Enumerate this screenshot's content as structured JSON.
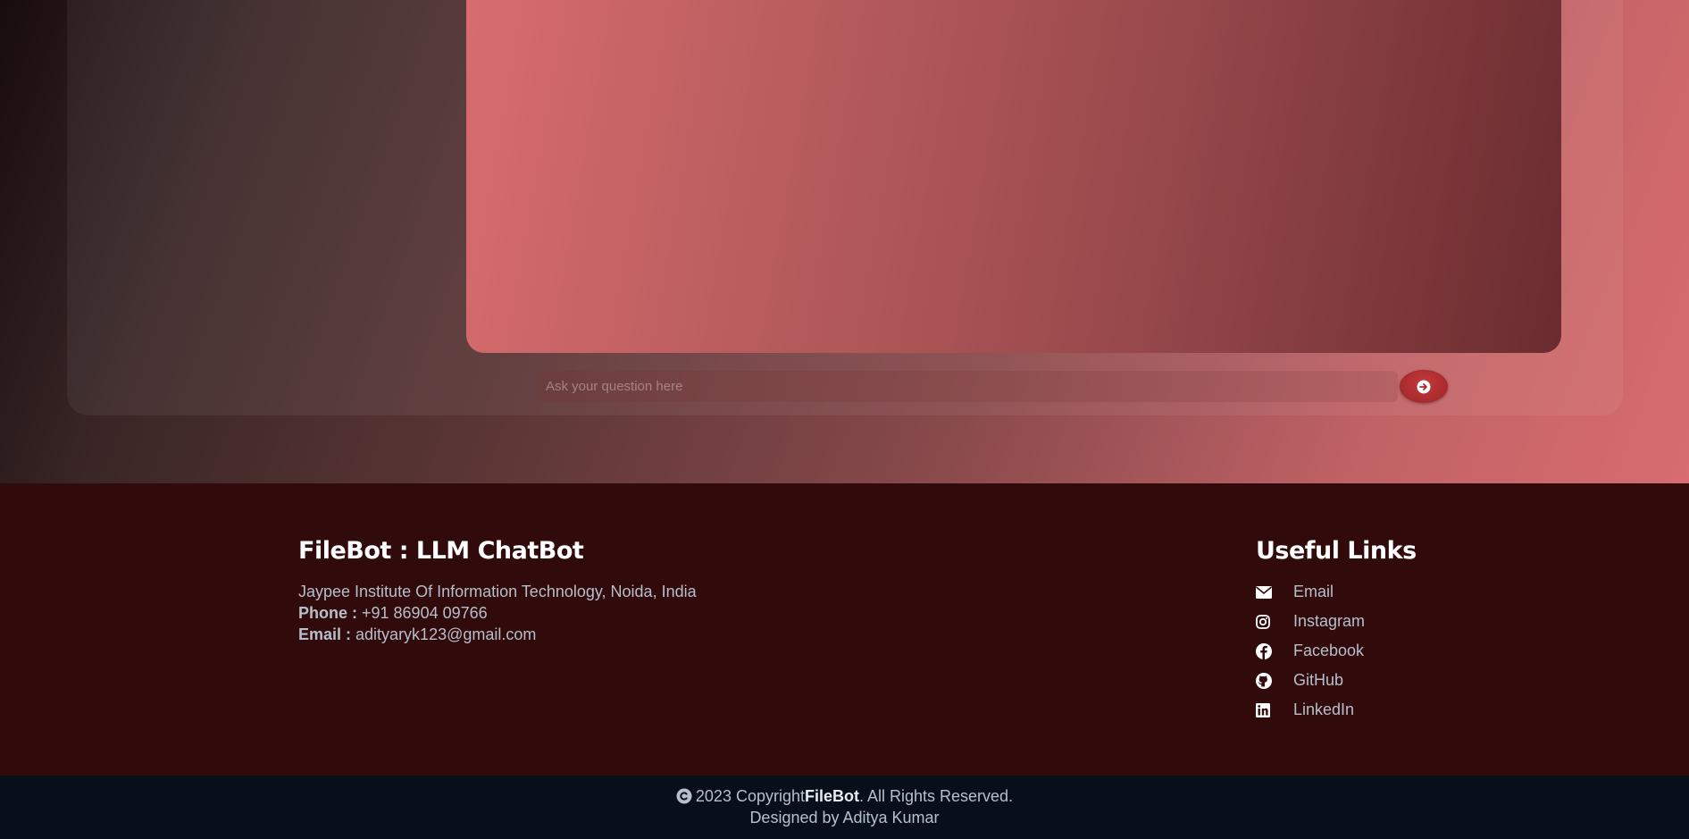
{
  "chat": {
    "input_placeholder": "Ask your question here",
    "send_icon": "arrow-right-circle-icon"
  },
  "footer": {
    "brand": {
      "title": "FileBot : LLM ChatBot",
      "address": "Jaypee Institute Of Information Technology, Noida, India",
      "phone_label": "Phone :",
      "phone_value": " +91 86904 09766",
      "email_label": "Email :",
      "email_value": " adityaryk123@gmail.com"
    },
    "useful_links": {
      "title": "Useful Links",
      "items": [
        {
          "label": "Email",
          "icon": "envelope-icon"
        },
        {
          "label": "Instagram",
          "icon": "instagram-icon"
        },
        {
          "label": "Facebook",
          "icon": "facebook-icon"
        },
        {
          "label": "GitHub",
          "icon": "github-icon"
        },
        {
          "label": "LinkedIn",
          "icon": "linkedin-icon"
        }
      ]
    },
    "copyright": {
      "icon": "copyright-icon",
      "year_text": "2023 Copyright ",
      "brand": "FileBot",
      "suffix": ". All Rights Reserved.",
      "designed_by": "Designed by Aditya Kumar"
    }
  },
  "colors": {
    "footer_bg": "#310a0c",
    "bottom_bar_bg": "#07101a",
    "send_button": "#b32f31",
    "link_text": "#b7bfca"
  }
}
